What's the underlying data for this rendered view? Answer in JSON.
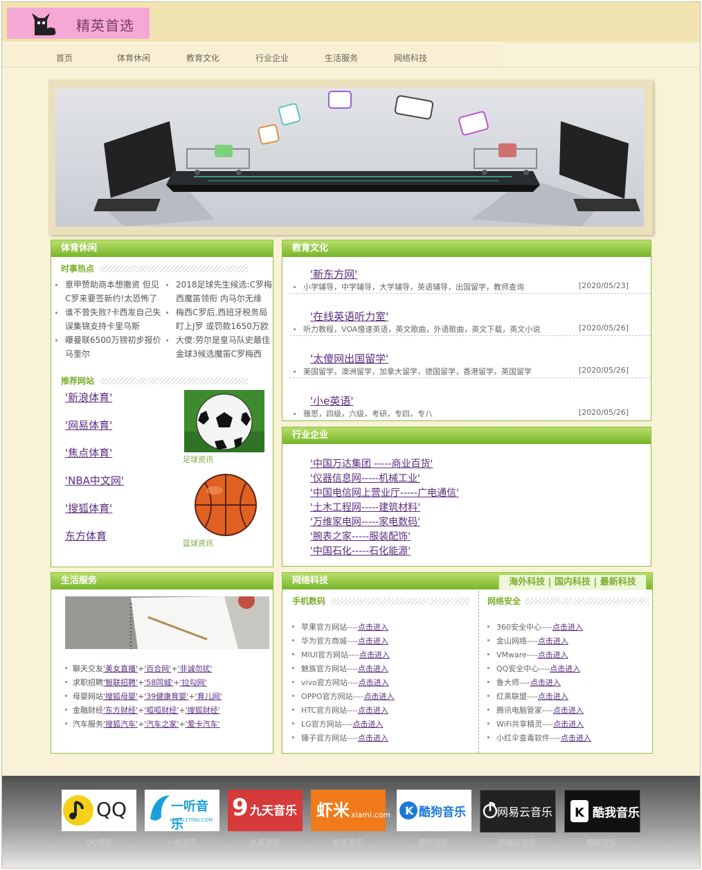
{
  "site": {
    "logo_text": "精英首选"
  },
  "nav": [
    "首页",
    "体育休闲",
    "教育文化",
    "行业企业",
    "生活服务",
    "网络科技"
  ],
  "sports": {
    "title": "体育休闲",
    "hot_title": "时事热点",
    "news_left": [
      "意甲赞助商本想撤资 但见",
      "C罗来要签新约!太恐怖了",
      "谁不曾失败?卡西发自己失",
      "误集锦支持卡里乌斯",
      "曝曼联6500万镑初步报价",
      "马奎尔"
    ],
    "news_right": [
      "2018足球先生候选:C罗梅",
      "西魔笛领衔 内马尔无缘",
      "梅西C罗后,西班牙税务局",
      "盯上J罗 或罚款1650万欧",
      "大傻:劳尔是皇马队史最佳",
      "金球3候选魔笛C罗梅西"
    ],
    "rec_title": "推荐网站",
    "links": [
      "'新浪体育'",
      "'网易体育'",
      "'焦点体育'",
      "'NBA中文网'",
      "'搜狐体育'",
      "东方体育"
    ],
    "captions": [
      "足球资讯",
      "篮球资讯"
    ]
  },
  "education": {
    "title": "教育文化",
    "items": [
      {
        "name": "'新东方网'",
        "desc": "小学辅导，中学辅导，大学辅导，英语辅导，出国留学，教师查询",
        "date": "[2020/05/23]"
      },
      {
        "name": "'在线英语听力室'",
        "desc": "听力教程，VOA慢速英语，英文歌曲，外语歌曲，英文下载，英文小说",
        "date": "[2020/05/26]"
      },
      {
        "name": "'太傻网出国留学'",
        "desc": "美国留学，澳洲留学，加拿大留学，德国留学，香港留学，英国留学",
        "date": "[2020/05/26]"
      },
      {
        "name": "'小e英语'",
        "desc": "雅思，四级，六级，考研，专四，专八",
        "date": "[2020/05/26]"
      }
    ]
  },
  "industry": {
    "title": "行业企业",
    "links": [
      "'中国万达集团 -----商业百货'",
      "'仪器信息网-----机械工业'",
      "'中国电信网上营业厅-----广电通信'",
      "'土木工程网-----建筑材料'",
      "'万维家电网-----家电数码'",
      "'腕表之家-----服装配饰'",
      "'中国石化-----石化能源'"
    ]
  },
  "life": {
    "title": "生活服务",
    "rows": [
      {
        "label": "聊天交友",
        "links": [
          "'美女直播'",
          "'百合网'",
          "'非诚勿扰'"
        ]
      },
      {
        "label": "求职招聘",
        "links": [
          "'智联招聘'",
          "'58同城'",
          "'拉勾网'"
        ]
      },
      {
        "label": "母婴网站",
        "links": [
          "'搜狐母婴'",
          "'39健康育婴'",
          "'育儿网'"
        ]
      },
      {
        "label": "金融财经",
        "links": [
          "'东方财经'",
          "'呱呱财经'",
          "'搜狐财经'"
        ]
      },
      {
        "label": "汽车服务",
        "links": [
          "'搜狐汽车'",
          "'汽车之家'",
          "'爱卡汽车'"
        ]
      }
    ]
  },
  "tech": {
    "title": "网络科技",
    "tabs": "海外科技 | 国内科技 | 最新科技",
    "mobile_title": "手机数码",
    "security_title": "网络安全",
    "link_text": "点击进入",
    "mobile": [
      "苹果官方网站----",
      "华为官方商城----",
      "MIUI官方网站----",
      "魅族官方网站----",
      "vivo官方网站----",
      "OPPO官方网站----",
      "HTC官方网站----",
      "LG官方网站----",
      "锤子官方网站----"
    ],
    "security": [
      "360安全中心----",
      "金山网络----",
      "VMware----",
      "QQ安全中心----",
      "鲁大师----",
      "红黑联盟----",
      "腾讯电脑管家----",
      "WiFi共享精灵----",
      "小红伞查毒软件----"
    ]
  },
  "footer": {
    "logos": [
      {
        "text": "QQ",
        "name": "QQ音乐"
      },
      {
        "text": "一听音乐",
        "sub": "WWW.1TING.COM",
        "name": "一听音乐"
      },
      {
        "text": "九天音乐",
        "name": "九天音乐"
      },
      {
        "text": "虾米",
        "sub": "xiami.com",
        "name": "虾米音乐"
      },
      {
        "text": "酷狗音乐",
        "name": "酷狗音乐"
      },
      {
        "text": "网易云音乐",
        "name": "网易云音乐"
      },
      {
        "text": "酷我音乐",
        "name": "酷我音乐"
      }
    ]
  },
  "colors": {
    "green": "#7bae2c",
    "link": "#5a2d80",
    "bg": "#f9f1d8"
  }
}
